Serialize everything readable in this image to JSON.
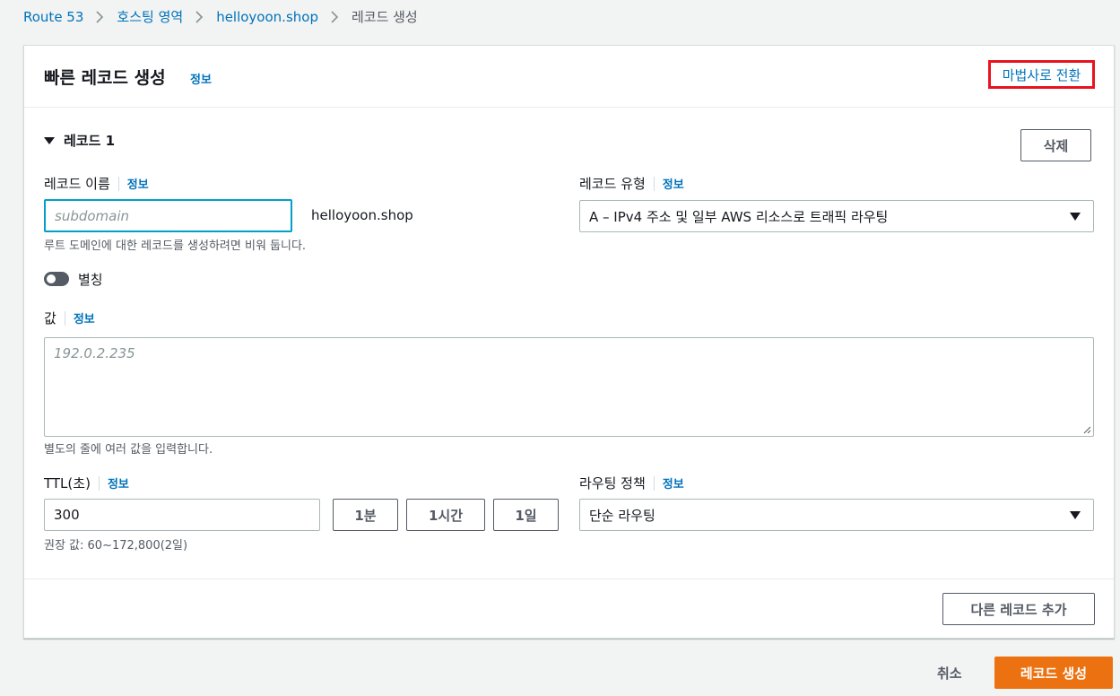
{
  "breadcrumb": {
    "items": [
      "Route 53",
      "호스팅 영역",
      "helloyoon.shop"
    ],
    "current": "레코드 생성"
  },
  "header": {
    "title": "빠른 레코드 생성",
    "info": "정보",
    "wizard_link": "마법사로 전환"
  },
  "record": {
    "section_title": "레코드 1",
    "delete_label": "삭제",
    "name": {
      "label": "레코드 이름",
      "info": "정보",
      "placeholder": "subdomain",
      "domain_suffix": "helloyoon.shop",
      "hint": "루트 도메인에 대한 레코드를 생성하려면 비워 둡니다."
    },
    "type": {
      "label": "레코드 유형",
      "info": "정보",
      "value": "A – IPv4 주소 및 일부 AWS 리소스로 트래픽 라우팅"
    },
    "alias": {
      "label": "별칭",
      "enabled": false
    },
    "value": {
      "label": "값",
      "info": "정보",
      "placeholder": "192.0.2.235",
      "hint": "별도의 줄에 여러 값을 입력합니다."
    },
    "ttl": {
      "label": "TTL(초)",
      "info": "정보",
      "value": "300",
      "presets": [
        "1분",
        "1시간",
        "1일"
      ],
      "hint": "권장 값: 60~172,800(2일)"
    },
    "routing": {
      "label": "라우팅 정책",
      "info": "정보",
      "value": "단순 라우팅"
    }
  },
  "add_record_label": "다른 레코드 추가",
  "footer": {
    "cancel_label": "취소",
    "create_label": "레코드 생성"
  },
  "colors": {
    "link": "#0073bb",
    "primary": "#ec7211",
    "highlight_box": "#e8131f",
    "focus": "#00a1c9"
  }
}
